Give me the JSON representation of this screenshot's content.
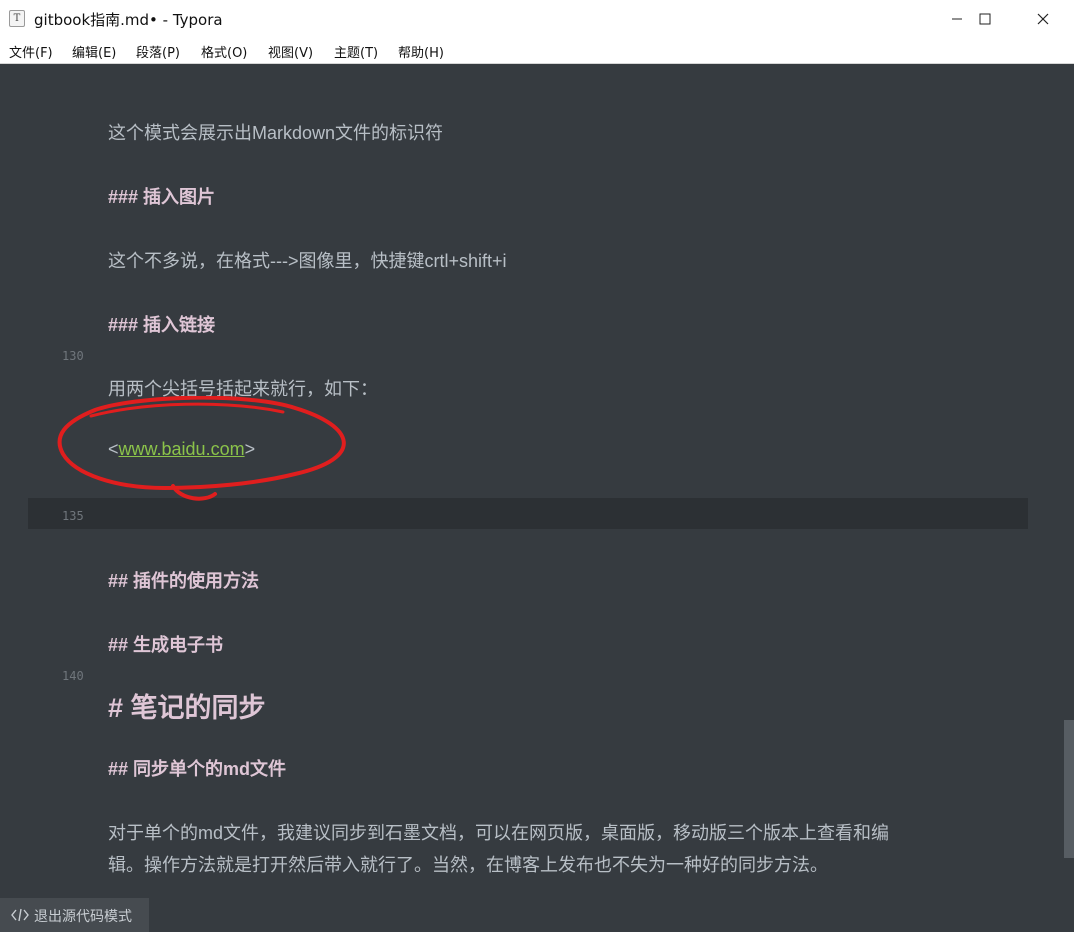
{
  "window": {
    "title": "gitbook指南.md• - Typora",
    "app_icon_glyph": "T"
  },
  "menu": [
    "文件(F)",
    "编辑(E)",
    "段落(P)",
    "格式(O)",
    "视图(V)",
    "主题(T)",
    "帮助(H)"
  ],
  "editor": {
    "lines": [
      "这个模式会展示出Markdown文件的标识符",
      "### 插入图片",
      "这个不多说，在格式--->图像里，快捷键crtl+shift+i",
      "### 插入链接",
      "用两个尖括号括起来就行，如下：",
      "## 插件的使用方法",
      "## 生成电子书",
      "# 笔记的同步",
      "## 同步单个的md文件",
      "对于单个的md文件，我建议同步到石墨文档，可以在网页版，桌面版，移动版三个版本上查看和编",
      "辑。操作方法就是打开然后带入就行了。当然，在博客上发布也不失为一种好的同步方法。"
    ],
    "link": {
      "open": "<",
      "url": "www.baidu.com",
      "close": ">"
    },
    "line_numbers": [
      "130",
      "135",
      "140"
    ]
  },
  "status": {
    "source_mode_label": "退出源代码模式",
    "icon": "code-icon"
  },
  "colors": {
    "background": "#363b40",
    "heading": "#dfc6d6",
    "text": "#b8bfc6",
    "link": "#8bc34a",
    "annotation": "#e01e1e"
  }
}
